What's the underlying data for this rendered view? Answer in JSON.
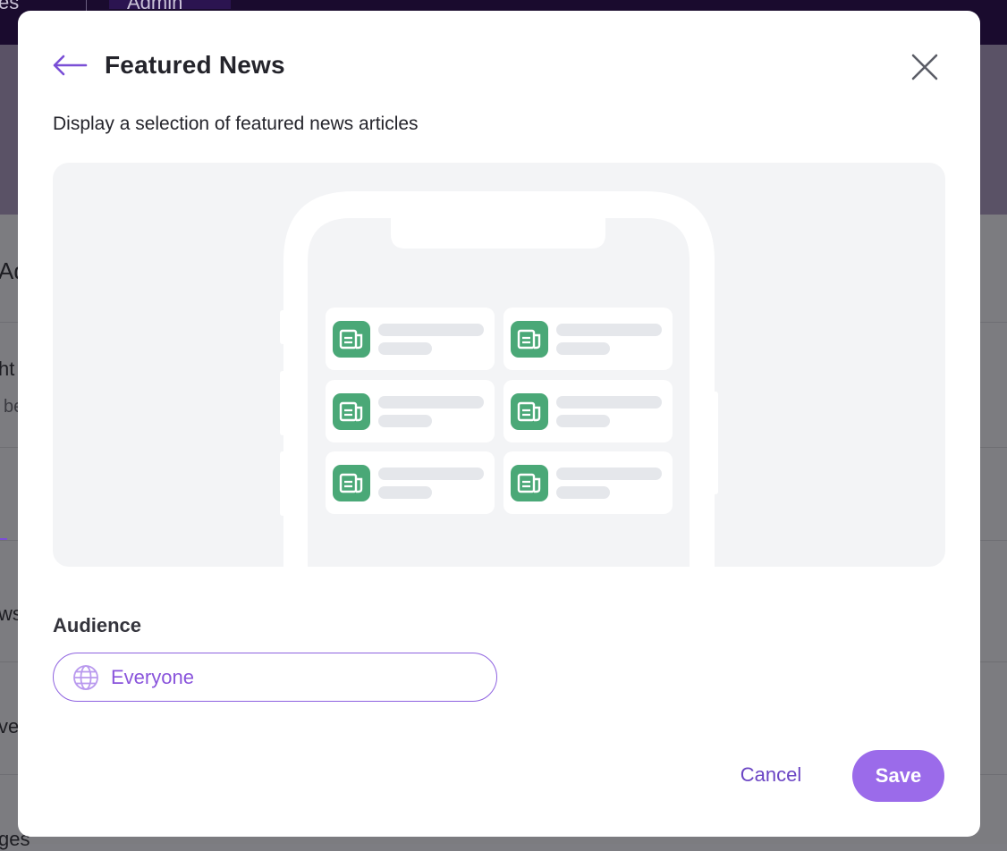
{
  "background": {
    "top_left_fragment": "es",
    "top_admin_fragment": "Admin",
    "side_fragments": [
      "Ad",
      "ht",
      "be",
      "ws",
      "ve",
      "ges"
    ]
  },
  "modal": {
    "title": "Featured News",
    "description": "Display a selection of featured news articles",
    "preview": {
      "tile_icon": "newspaper-icon",
      "tile_icon_color": "#4aa877",
      "tile_count": 6
    },
    "audience": {
      "label": "Audience",
      "value": "Everyone",
      "icon": "globe-icon"
    },
    "buttons": {
      "cancel": "Cancel",
      "save": "Save"
    },
    "colors": {
      "accent": "#9b6bea",
      "accent_text": "#8a55dc",
      "cancel_text": "#6b45c4"
    }
  }
}
